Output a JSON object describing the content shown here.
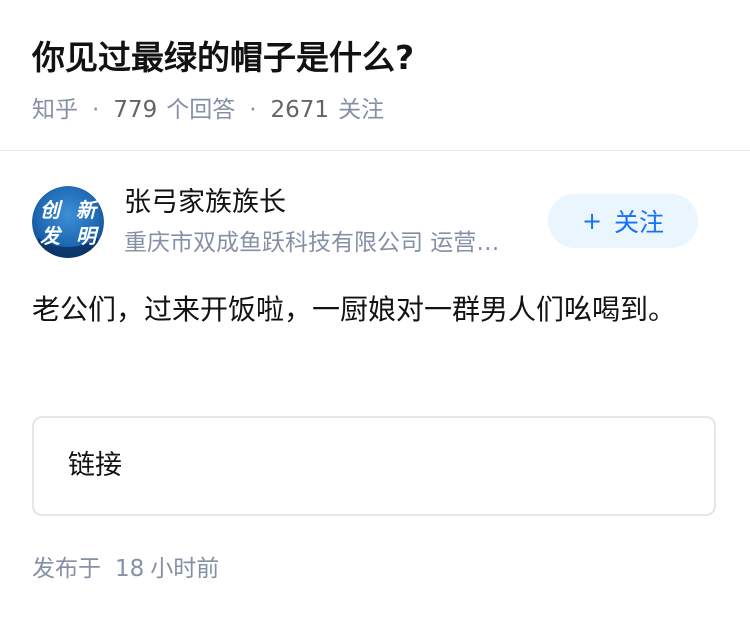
{
  "question": {
    "title": "你见过最绿的帽子是什么?"
  },
  "meta": {
    "source": "知乎",
    "answers_count": "779",
    "answers_label": "个回答",
    "followers_count": "2671",
    "followers_label": "关注"
  },
  "author": {
    "name": "张弓家族族长",
    "bio": "重庆市双成鱼跃科技有限公司 运营总监",
    "avatar_chars": [
      "创",
      "新",
      "发",
      "明"
    ],
    "follow_plus": "+",
    "follow_label": "关注"
  },
  "answer": {
    "text": "老公们，过来开饭啦，一厨娘对一群男人们吆喝到。",
    "link_label": "链接"
  },
  "footer": {
    "publish_prefix": "发布于",
    "publish_number": "18",
    "publish_suffix": "小时前"
  },
  "colors": {
    "accent": "#1772f6",
    "follow_bg": "#ebf5fd",
    "meta_gray": "#8590a6",
    "title_black": "#121212"
  },
  "icons": {
    "avatar": "avatar-image"
  }
}
